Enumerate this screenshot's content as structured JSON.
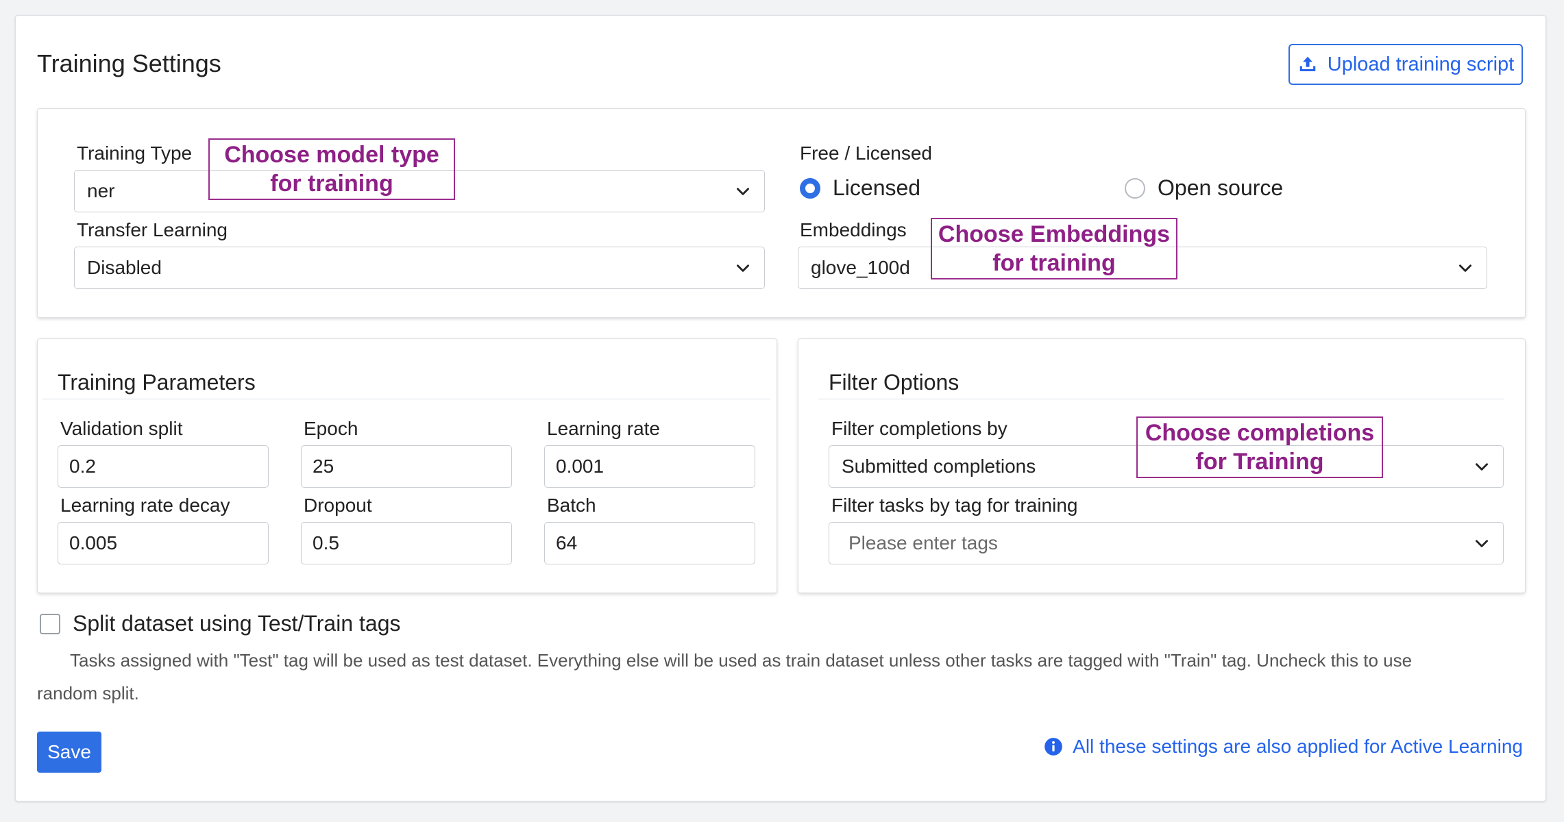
{
  "header": {
    "title": "Training Settings",
    "upload_label": "Upload training script"
  },
  "model_panel": {
    "training_type": {
      "label": "Training Type",
      "value": "ner"
    },
    "transfer_learning": {
      "label": "Transfer Learning",
      "value": "Disabled"
    },
    "license": {
      "label": "Free / Licensed",
      "options": [
        "Licensed",
        "Open source"
      ],
      "selected": "Licensed"
    },
    "embeddings": {
      "label": "Embeddings",
      "value": "glove_100d"
    }
  },
  "params_panel": {
    "title": "Training Parameters",
    "fields": {
      "validation_split": {
        "label": "Validation split",
        "value": "0.2"
      },
      "epoch": {
        "label": "Epoch",
        "value": "25"
      },
      "learning_rate": {
        "label": "Learning rate",
        "value": "0.001"
      },
      "learning_rate_decay": {
        "label": "Learning rate decay",
        "value": "0.005"
      },
      "dropout": {
        "label": "Dropout",
        "value": "0.5"
      },
      "batch": {
        "label": "Batch",
        "value": "64"
      }
    }
  },
  "filter_panel": {
    "title": "Filter Options",
    "completions": {
      "label": "Filter completions by",
      "value": "Submitted completions"
    },
    "tags": {
      "label": "Filter tasks by tag for training",
      "placeholder": "Please enter tags"
    }
  },
  "annotations": {
    "model_type": [
      "Choose model type",
      "for training"
    ],
    "embeddings": [
      "Choose Embeddings",
      "for training"
    ],
    "completions": [
      "Choose completions",
      "for Training"
    ]
  },
  "split": {
    "label": "Split dataset using Test/Train tags",
    "checked": false,
    "help_line1": "Tasks assigned with \"Test\" tag will be used as test dataset. Everything else will be used as train dataset unless other tasks are tagged with \"Train\" tag. Uncheck this to use",
    "help_line2": "random split."
  },
  "footer": {
    "save_label": "Save",
    "info_text": "All these settings are also applied for Active Learning"
  },
  "colors": {
    "accent": "#2f6fe4",
    "annotation": "#8e2086"
  }
}
